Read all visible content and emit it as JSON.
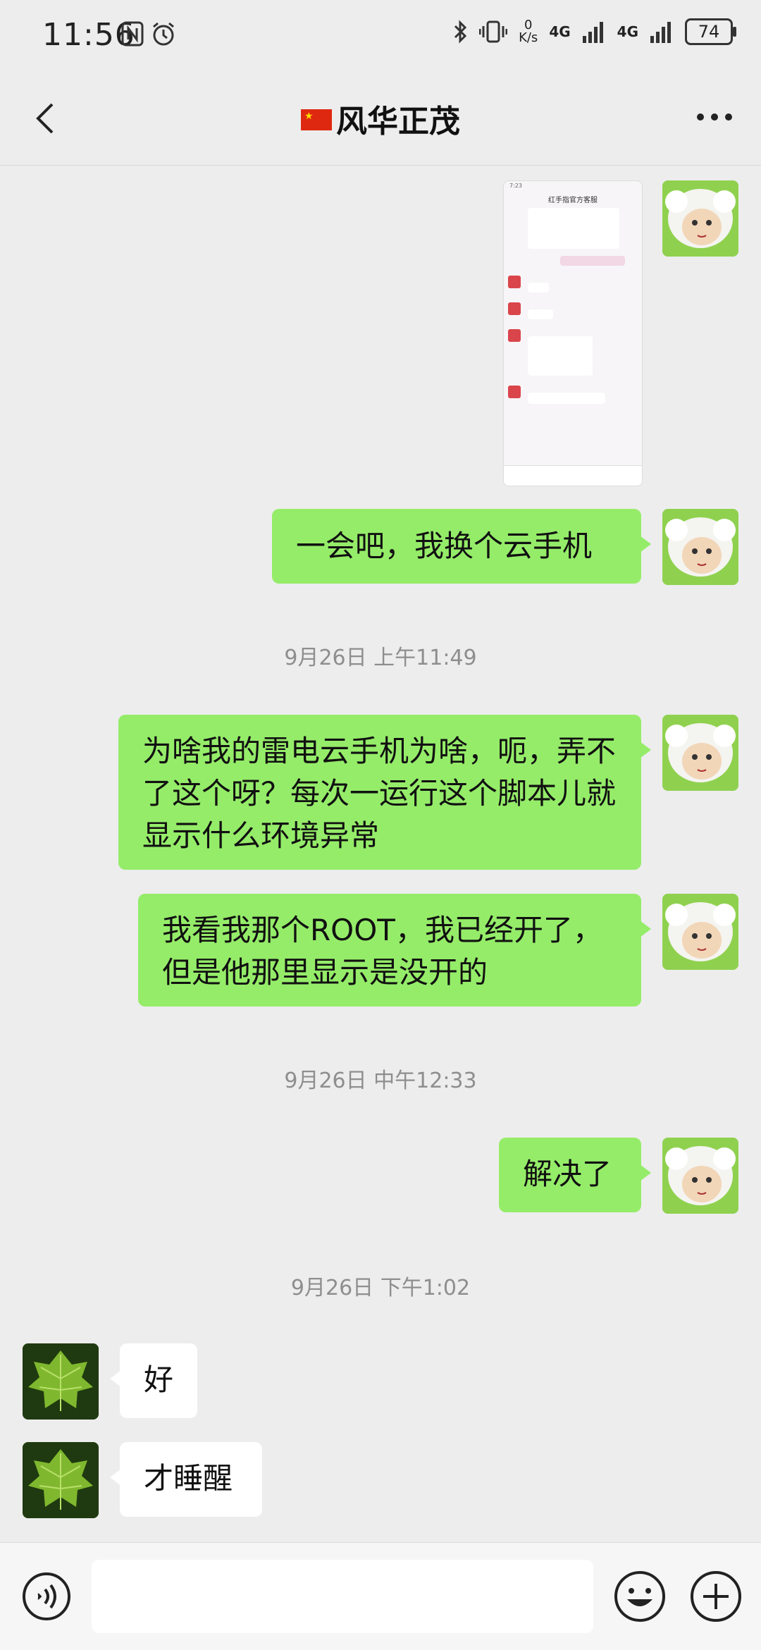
{
  "status_bar": {
    "time": "11:56",
    "net_speed_top": "0",
    "net_speed_bottom": "K/s",
    "sim1": "4G",
    "sim2": "4G",
    "battery": "74"
  },
  "header": {
    "title": "风华正茂"
  },
  "messages": [
    {
      "from": "me",
      "type": "image"
    },
    {
      "from": "me",
      "type": "text",
      "text": "一会吧，我换个云手机"
    },
    {
      "type": "timestamp",
      "text": "9月26日 上午11:49"
    },
    {
      "from": "me",
      "type": "text",
      "text": "为啥我的雷电云手机为啥，呃，弄不了这个呀？每次一运行这个脚本儿就显示什么环境异常"
    },
    {
      "from": "me",
      "type": "text",
      "text": "我看我那个ROOT，我已经开了，但是他那里显示是没开的"
    },
    {
      "type": "timestamp",
      "text": "9月26日 中午12:33"
    },
    {
      "from": "me",
      "type": "text",
      "text": "解决了"
    },
    {
      "type": "timestamp",
      "text": "9月26日 下午1:02"
    },
    {
      "from": "other",
      "type": "text",
      "text": "好"
    },
    {
      "from": "other",
      "type": "text",
      "text": "才睡醒"
    }
  ],
  "screenshot_image": {
    "title": "红手指官方客服",
    "time": "7:23"
  },
  "colors": {
    "my_bubble": "#95ec69",
    "their_bubble": "#ffffff",
    "background": "#ededed"
  }
}
